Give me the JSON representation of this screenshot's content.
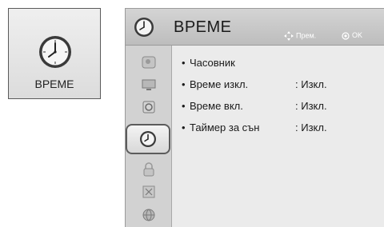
{
  "tile": {
    "label": "ВРЕМЕ",
    "icon": "clock-icon"
  },
  "header": {
    "title": "ВРЕМЕ",
    "hint_move": "Прем.",
    "hint_ok": "OK"
  },
  "sidebar": {
    "items": [
      {
        "icon": "picture-icon"
      },
      {
        "icon": "screen-icon"
      },
      {
        "icon": "speaker-icon"
      },
      {
        "icon": "clock-icon",
        "active": true
      },
      {
        "icon": "lock-icon"
      },
      {
        "icon": "options-icon"
      },
      {
        "icon": "globe-icon"
      }
    ]
  },
  "menu": {
    "bullet": "•",
    "items": [
      {
        "label": "Часовник",
        "value": ""
      },
      {
        "label": "Време изкл.",
        "value": ": Изкл."
      },
      {
        "label": "Време вкл.",
        "value": ": Изкл."
      },
      {
        "label": "Таймер за сън",
        "value": ": Изкл."
      }
    ]
  },
  "colors": {
    "panel_bg": "#ebebeb",
    "header_bg": "#c8c8c8",
    "sidebar_bg": "#d2d2d2",
    "active_border": "#5c5c5c"
  }
}
